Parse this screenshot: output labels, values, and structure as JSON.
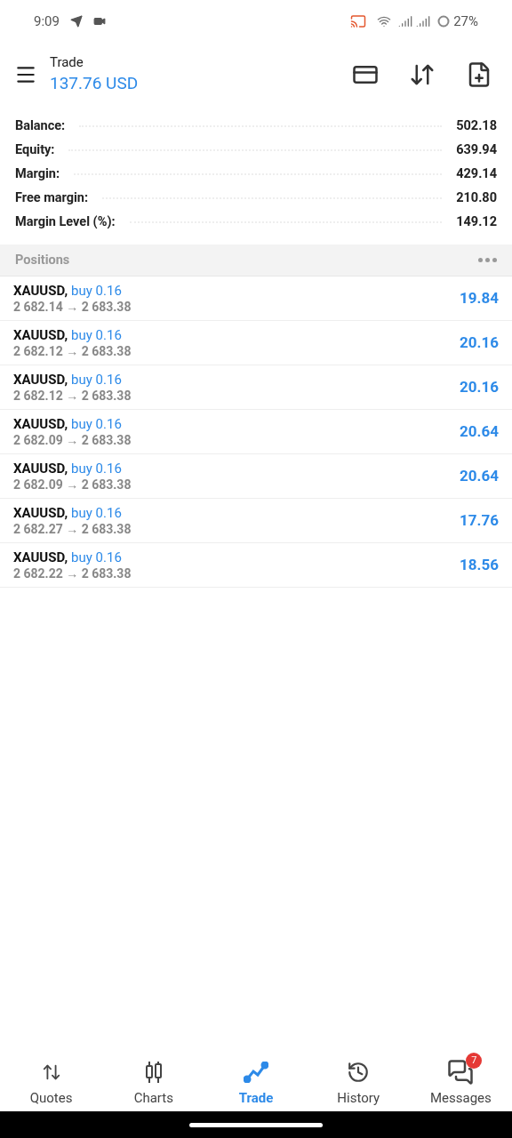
{
  "status_bar": {
    "time": "9:09",
    "battery": "27%"
  },
  "header": {
    "title": "Trade",
    "amount": "137.76 USD"
  },
  "summary": [
    {
      "label": "Balance:",
      "value": "502.18"
    },
    {
      "label": "Equity:",
      "value": "639.94"
    },
    {
      "label": "Margin:",
      "value": "429.14"
    },
    {
      "label": "Free margin:",
      "value": "210.80"
    },
    {
      "label": "Margin Level (%):",
      "value": "149.12"
    }
  ],
  "positions_header": {
    "title": "Positions"
  },
  "positions": [
    {
      "symbol": "XAUUSD,",
      "side": "buy 0.16",
      "prices": "2 682.14 → 2 683.38",
      "profit": "19.84"
    },
    {
      "symbol": "XAUUSD,",
      "side": "buy 0.16",
      "prices": "2 682.12 → 2 683.38",
      "profit": "20.16"
    },
    {
      "symbol": "XAUUSD,",
      "side": "buy 0.16",
      "prices": "2 682.12 → 2 683.38",
      "profit": "20.16"
    },
    {
      "symbol": "XAUUSD,",
      "side": "buy 0.16",
      "prices": "2 682.09 → 2 683.38",
      "profit": "20.64"
    },
    {
      "symbol": "XAUUSD,",
      "side": "buy 0.16",
      "prices": "2 682.09 → 2 683.38",
      "profit": "20.64"
    },
    {
      "symbol": "XAUUSD,",
      "side": "buy 0.16",
      "prices": "2 682.27 → 2 683.38",
      "profit": "17.76"
    },
    {
      "symbol": "XAUUSD,",
      "side": "buy 0.16",
      "prices": "2 682.22 → 2 683.38",
      "profit": "18.56"
    }
  ],
  "bottom_nav": [
    {
      "kind": "quotes",
      "label": "Quotes",
      "selected": false
    },
    {
      "kind": "charts",
      "label": "Charts",
      "selected": false
    },
    {
      "kind": "trade",
      "label": "Trade",
      "selected": true
    },
    {
      "kind": "history",
      "label": "History",
      "selected": false
    },
    {
      "kind": "messages",
      "label": "Messages",
      "selected": false,
      "badge": "7"
    }
  ]
}
